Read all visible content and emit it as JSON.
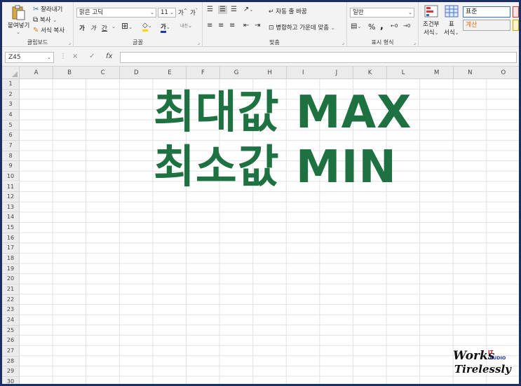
{
  "ribbon": {
    "clipboard": {
      "paste": "붙여넣기",
      "cut": "잘라내기",
      "copy": "복사",
      "format_painter": "서식 복사",
      "label": "클립보드"
    },
    "font": {
      "font_name": "맑은 고딕",
      "font_size": "11",
      "grow": "가",
      "shrink": "가",
      "bold": "가",
      "italic": "가",
      "underline": "간",
      "font_color_glyph": "가",
      "phonetic": "내천",
      "label": "글꼴"
    },
    "alignment": {
      "wrap_text": "자동 줄 바꿈",
      "merge_center": "병합하고 가운데 맞춤",
      "label": "맞춤"
    },
    "number": {
      "format": "일반",
      "percent": "%",
      "comma": ",",
      "label": "표시 형식"
    },
    "styles": {
      "conditional": [
        "조건부",
        "서식"
      ],
      "table": [
        "표",
        "서식"
      ],
      "normal": "표준",
      "calc": "계산"
    }
  },
  "formula_bar": {
    "name_box": "Z45",
    "cancel": "×",
    "enter": "✓",
    "fx": "fx",
    "value": ""
  },
  "columns": [
    "A",
    "B",
    "C",
    "D",
    "E",
    "F",
    "G",
    "H",
    "I",
    "J",
    "K",
    "L",
    "M",
    "N",
    "O"
  ],
  "rows": [
    "1",
    "2",
    "3",
    "4",
    "5",
    "6",
    "7",
    "8",
    "9",
    "10",
    "11",
    "12",
    "13",
    "14",
    "15",
    "16",
    "17",
    "18",
    "19",
    "20",
    "21",
    "22",
    "23",
    "24",
    "25",
    "26",
    "27",
    "28",
    "29",
    "30"
  ],
  "title_lines": [
    "최대값 MAX",
    "최소값 MIN"
  ],
  "watermark": {
    "line1": "Works",
    "line2": "Tirelessly",
    "tag1": "IT",
    "tag2": "AUDIO"
  },
  "colors": {
    "title": "#1e7141",
    "frame": "#1b2f66",
    "calc_text": "#e46c0a",
    "calc_bg": "#f2f2f2"
  }
}
